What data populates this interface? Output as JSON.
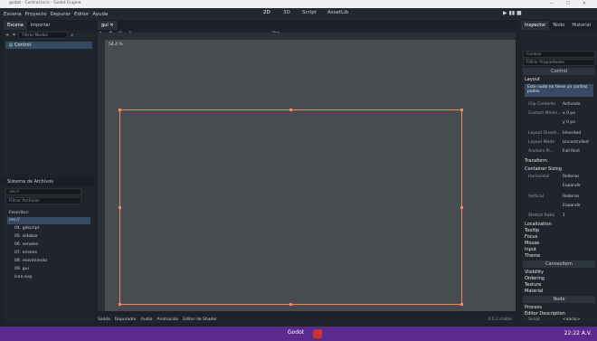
{
  "window": {
    "title": "godot - Control.tscn - Godot Engine",
    "controls": "— ☐ ✕"
  },
  "menu": [
    "Escena",
    "Proyecto",
    "Depurar",
    "Editor",
    "Ayuda"
  ],
  "workspaces": [
    "2D",
    "3D",
    "Script",
    "AssetLib"
  ],
  "scene_panel": {
    "tabs": [
      "Escena",
      "Importar"
    ],
    "filter_placeholder": "Filtrar Nodos",
    "root_node": "Control"
  },
  "viewport": {
    "tab": "gui",
    "zoom": "Ver",
    "zoom_pct": "54.4 %"
  },
  "filesystem": {
    "title": "Sistema de Archivos",
    "path": "res://",
    "filter_placeholder": "Filtrar Archivos",
    "items": [
      "Favoritos:",
      "res://",
      "04. gdscript",
      "05. sidebar",
      "06. senales",
      "07. errores",
      "08. movimiento",
      "09. gui",
      "icon.svg"
    ]
  },
  "bottom_tabs": [
    "Salida",
    "Depurador",
    "Audio",
    "Animación",
    "Editor de Shader"
  ],
  "version": "4.0.2.stable",
  "inspector": {
    "tabs": [
      "Inspector",
      "Nodo",
      "Historial"
    ],
    "node": "Control",
    "filter_placeholder": "Filtrar Propiedades",
    "class_header": "Control",
    "layout_label": "Layout",
    "warning": "Este nodo no tiene un control padre.",
    "props": [
      {
        "k": "Clip Contents",
        "v": "Activado"
      },
      {
        "k": "Custom Minim...",
        "v": "x 0 px"
      },
      {
        "k": "",
        "v": "y 0 px"
      },
      {
        "k": "Layout Directi...",
        "v": "Inherited"
      },
      {
        "k": "Layout Mode",
        "v": "Uncontrolled"
      },
      {
        "k": "Anchors Pr...",
        "v": "Full Rect"
      }
    ],
    "transform": "Transform",
    "container_sizing": "Container Sizing",
    "horizontal": {
      "k": "Horizontal",
      "v": "Rellenar",
      "expand": "Expandir"
    },
    "vertical": {
      "k": "Vertical",
      "v": "Rellenar",
      "expand": "Expandir"
    },
    "stretch": {
      "k": "Stretch Ratio",
      "v": "1"
    },
    "groups": [
      "Localization",
      "Tooltip",
      "Focus",
      "Mouse",
      "Input",
      "Theme"
    ],
    "canvas_header": "CanvasItem",
    "groups2": [
      "Visibility",
      "Ordering",
      "Texture",
      "Material"
    ],
    "node_header": "Node",
    "groups3": [
      "Process",
      "Editor Description"
    ],
    "script": {
      "k": "Script",
      "v": "<vacío>"
    }
  },
  "taskbar": {
    "app": "Godot",
    "time": "22:22 A.V."
  }
}
